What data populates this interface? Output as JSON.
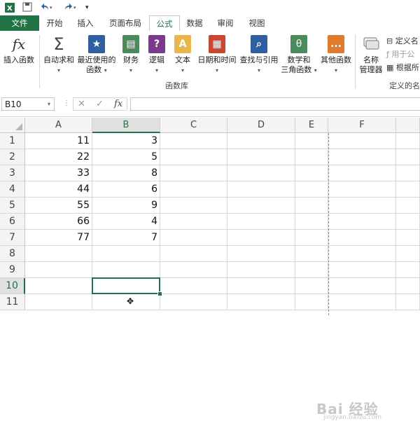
{
  "qat": {
    "excel_icon": "excel-logo-icon",
    "save_icon": "save-icon",
    "undo_icon": "undo-icon",
    "redo_icon": "redo-icon",
    "customize_icon": "customize-qat-icon"
  },
  "tabs": [
    "文件",
    "开始",
    "插入",
    "页面布局",
    "公式",
    "数据",
    "审阅",
    "视图"
  ],
  "active_tab": "公式",
  "ribbon": {
    "insert_function": {
      "icon_text": "fx",
      "label": "插入函数"
    },
    "autosum": {
      "icon_text": "Σ",
      "label": "自动求和"
    },
    "recent": {
      "label1": "最近使用的",
      "label2": "函数"
    },
    "financial": {
      "label": "财务"
    },
    "logical": {
      "icon_text": "?",
      "label": "逻辑"
    },
    "text": {
      "icon_text": "A",
      "label": "文本"
    },
    "datetime": {
      "label": "日期和时间"
    },
    "lookup": {
      "label": "查找与引用"
    },
    "math": {
      "icon_text": "θ",
      "label1": "数学和",
      "label2": "三角函数"
    },
    "more": {
      "icon_text": "...",
      "label": "其他函数"
    },
    "name_manager": {
      "label1": "名称",
      "label2": "管理器"
    },
    "define_name": "定义名",
    "use_in_formula": "用于公",
    "create_from_selection": "根据所",
    "group_label": "函数库",
    "group_label2": "定义的名"
  },
  "formula_bar": {
    "name_box": "B10",
    "cancel_icon": "cancel-icon",
    "enter_icon": "enter-icon",
    "fx_icon": "fx",
    "formula": ""
  },
  "columns": [
    "A",
    "B",
    "C",
    "D",
    "E",
    "F"
  ],
  "selected_column": "B",
  "rows": [
    "1",
    "2",
    "3",
    "4",
    "5",
    "6",
    "7",
    "8",
    "9",
    "10",
    "11"
  ],
  "selected_row": "10",
  "cells": [
    {
      "row": 1,
      "A": "11",
      "B": "3"
    },
    {
      "row": 2,
      "A": "22",
      "B": "5"
    },
    {
      "row": 3,
      "A": "33",
      "B": "8"
    },
    {
      "row": 4,
      "A": "44",
      "B": "6"
    },
    {
      "row": 5,
      "A": "55",
      "B": "9"
    },
    {
      "row": 6,
      "A": "66",
      "B": "4"
    },
    {
      "row": 7,
      "A": "77",
      "B": "7"
    }
  ],
  "watermark": "Bai 经验",
  "watermark_sub": "jingyan.baidu.com",
  "colors": {
    "accent": "#217346"
  }
}
